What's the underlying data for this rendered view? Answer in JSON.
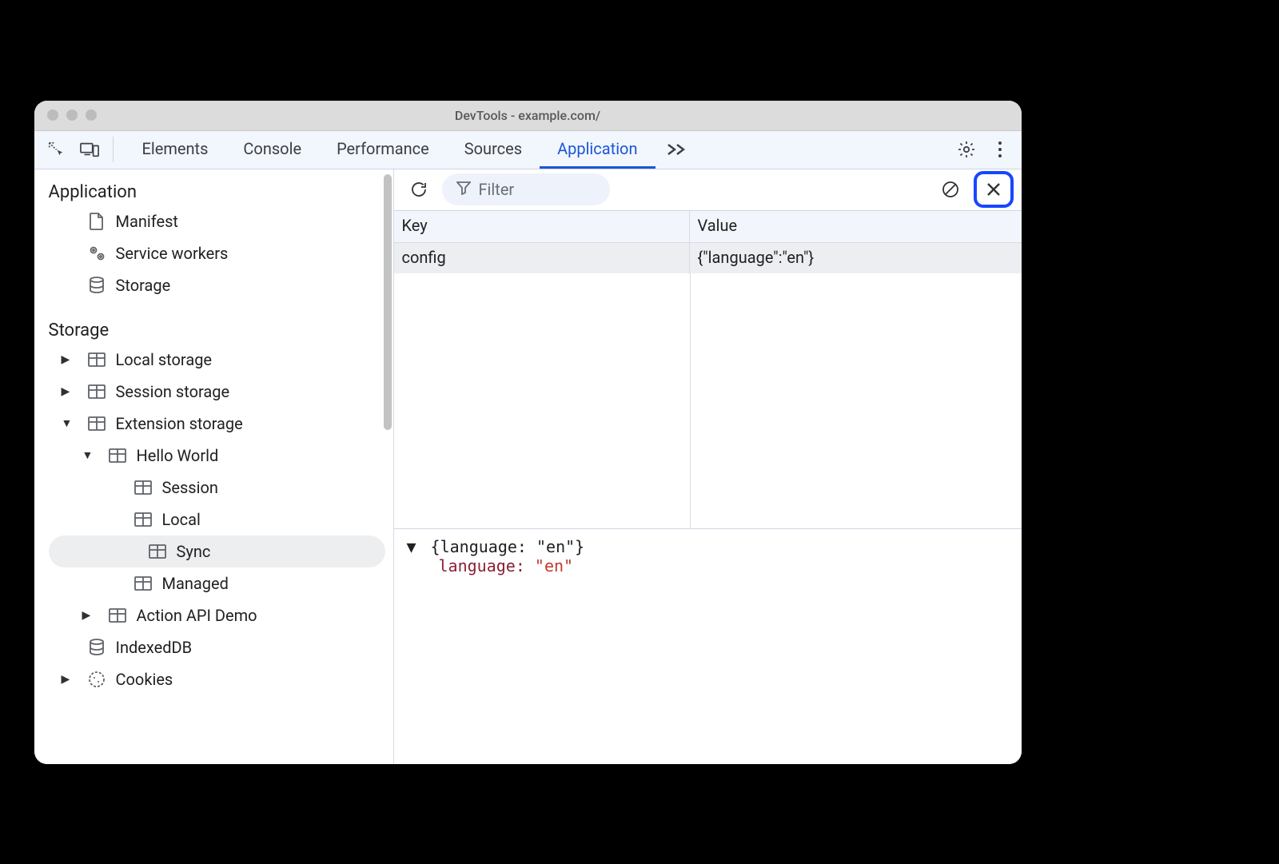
{
  "window": {
    "title": "DevTools - example.com/"
  },
  "tabs": {
    "items": [
      "Elements",
      "Console",
      "Performance",
      "Sources",
      "Application"
    ],
    "active_index": 4
  },
  "sidebar": {
    "groups": [
      {
        "title": "Application",
        "items": [
          {
            "label": "Manifest",
            "icon": "file"
          },
          {
            "label": "Service workers",
            "icon": "gears"
          },
          {
            "label": "Storage",
            "icon": "database"
          }
        ]
      },
      {
        "title": "Storage",
        "items": [
          {
            "label": "Local storage",
            "icon": "table",
            "expander": "closed"
          },
          {
            "label": "Session storage",
            "icon": "table",
            "expander": "closed"
          },
          {
            "label": "Extension storage",
            "icon": "table",
            "expander": "open",
            "children": [
              {
                "label": "Hello World",
                "icon": "table",
                "expander": "open",
                "children": [
                  {
                    "label": "Session",
                    "icon": "table"
                  },
                  {
                    "label": "Local",
                    "icon": "table"
                  },
                  {
                    "label": "Sync",
                    "icon": "table",
                    "selected": true
                  },
                  {
                    "label": "Managed",
                    "icon": "table"
                  }
                ]
              },
              {
                "label": "Action API Demo",
                "icon": "table",
                "expander": "closed"
              }
            ]
          },
          {
            "label": "IndexedDB",
            "icon": "database"
          },
          {
            "label": "Cookies",
            "icon": "cookie",
            "expander": "closed"
          }
        ]
      }
    ]
  },
  "filter": {
    "placeholder": "Filter"
  },
  "table": {
    "headers": {
      "key": "Key",
      "value": "Value"
    },
    "rows": [
      {
        "key": "config",
        "value": "{\"language\":\"en\"}"
      }
    ]
  },
  "preview": {
    "summary": "{language: \"en\"}",
    "prop_key": "language:",
    "prop_val": "\"en\""
  }
}
